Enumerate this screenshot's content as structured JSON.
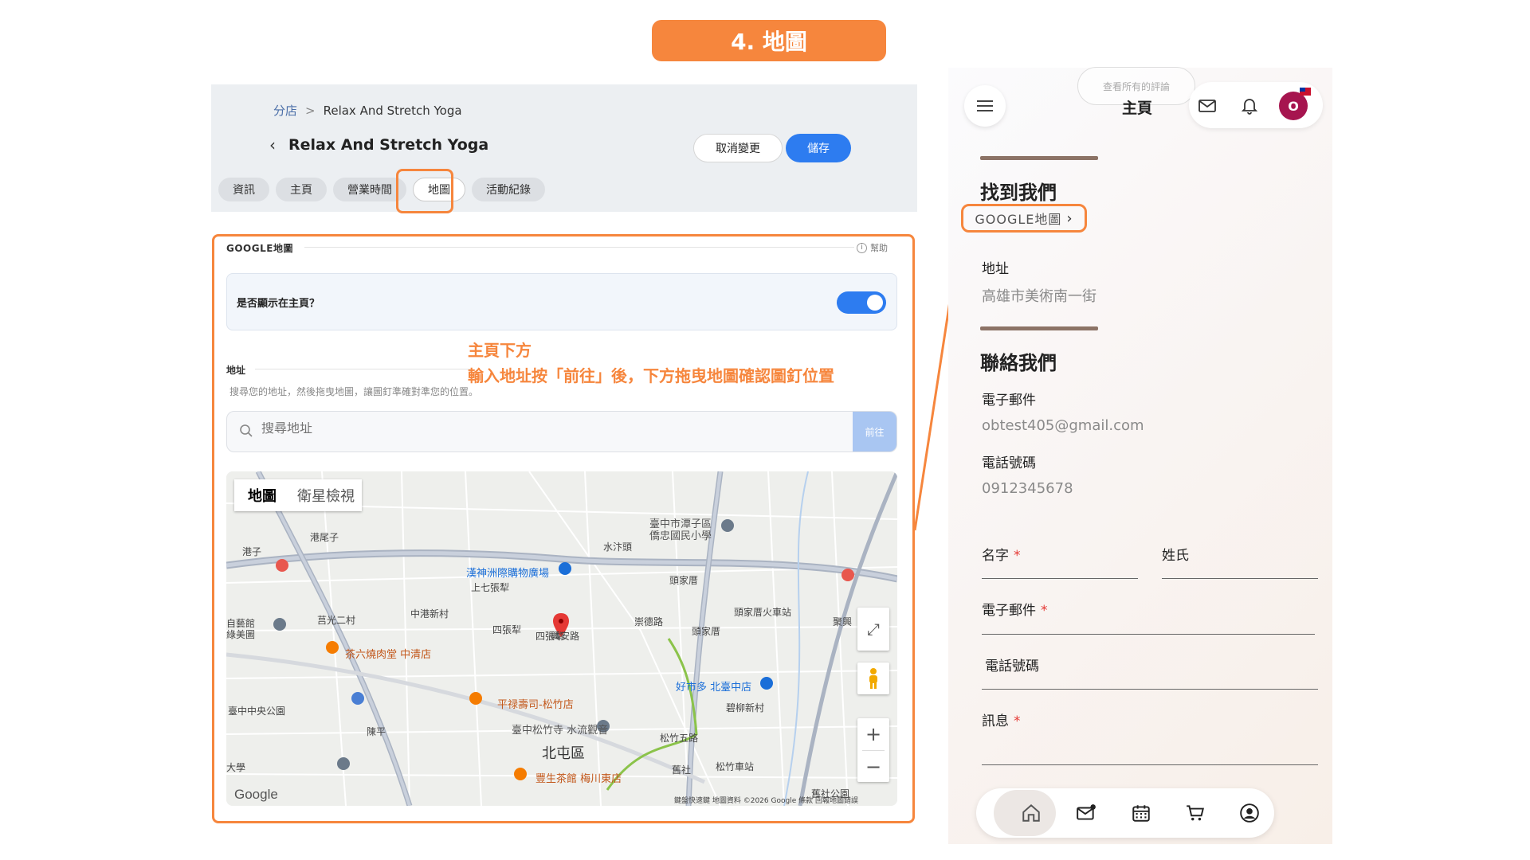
{
  "step_banner": "4. 地圖",
  "admin": {
    "breadcrumb": {
      "parent": "分店",
      "separator": ">",
      "current": "Relax And Stretch Yoga"
    },
    "page_title": "Relax And Stretch Yoga",
    "buttons": {
      "cancel": "取消變更",
      "save": "儲存"
    },
    "tabs": [
      "資訊",
      "主頁",
      "營業時間",
      "地圖",
      "活動紀錄"
    ],
    "active_tab": "地圖",
    "section_title": "GOOGLE地圖",
    "help": "幫助",
    "show_on_home_label": "是否顯示在主頁？",
    "show_on_home": true,
    "address_label": "地址",
    "address_hint": "搜尋您的地址，然後拖曳地圖，讓圖釘準確對準您的位置。",
    "search_placeholder": "搜尋地址",
    "search_button": "前往"
  },
  "annotation": {
    "line1": "主頁下方",
    "line2": "輸入地址按「前往」後，下方拖曳地圖確認圖釘位置"
  },
  "map": {
    "type_buttons": {
      "map": "地圖",
      "satellite": "衛星檢視"
    },
    "labels": {
      "l1": "港尾子",
      "l2": "港子",
      "l3": "水汴頭",
      "l4": "上七張犁",
      "l5": "中港新村",
      "l6": "四張犁",
      "l7": "四張犁",
      "l8": "頭家厝",
      "l9": "頭家厝",
      "l10": "頭家厝火車站",
      "l11": "碧柳新村",
      "l12": "北屯區",
      "l13": "大學",
      "l14": "臺中中央公園",
      "l15": "陳平",
      "l16": "松竹五路",
      "l17": "舊社",
      "l18": "舊社公園",
      "l19": "聚興",
      "l20": "興安路",
      "l21": "崇德路",
      "l22": "松竹車站",
      "l23": "莒光二村",
      "l24": "自藝館",
      "l25": "綠美圖",
      "poi1": "臺中市潭子區僑忠國民小學",
      "poi2": "漢神洲際購物廣場",
      "poi3": "茶六燒肉堂 中清店",
      "poi4": "平禄壽司-松竹店",
      "poi5": "臺中松竹寺 水流觀音",
      "poi6": "好市多 北臺中店",
      "poi7": "豐生茶館 梅川東店"
    },
    "google": "Google",
    "attribution": "鍵盤快速鍵   地圖資料 ©2026 Google   條款   回報地圖錯誤"
  },
  "mobile": {
    "header_title": "主頁",
    "reviews_pill": "查看所有的評論",
    "avatar": "O",
    "find_us_title": "找到我們",
    "gmap_link": "GOOGLE地圖",
    "address_label": "地址",
    "address_value": "高雄市美術南一街",
    "contact_title": "聯絡我們",
    "email_label": "電子郵件",
    "email_value": "obtest405@gmail.com",
    "phone_label": "電話號碼",
    "phone_value": "0912345678",
    "form": {
      "first_name": "名字",
      "last_name": "姓氏",
      "email": "電子郵件",
      "phone": "電話號碼",
      "message": "訊息",
      "required_mark": "*"
    }
  },
  "colors": {
    "accent": "#f6863d",
    "primary": "#2d7cf0",
    "avatar": "#a6154f"
  }
}
